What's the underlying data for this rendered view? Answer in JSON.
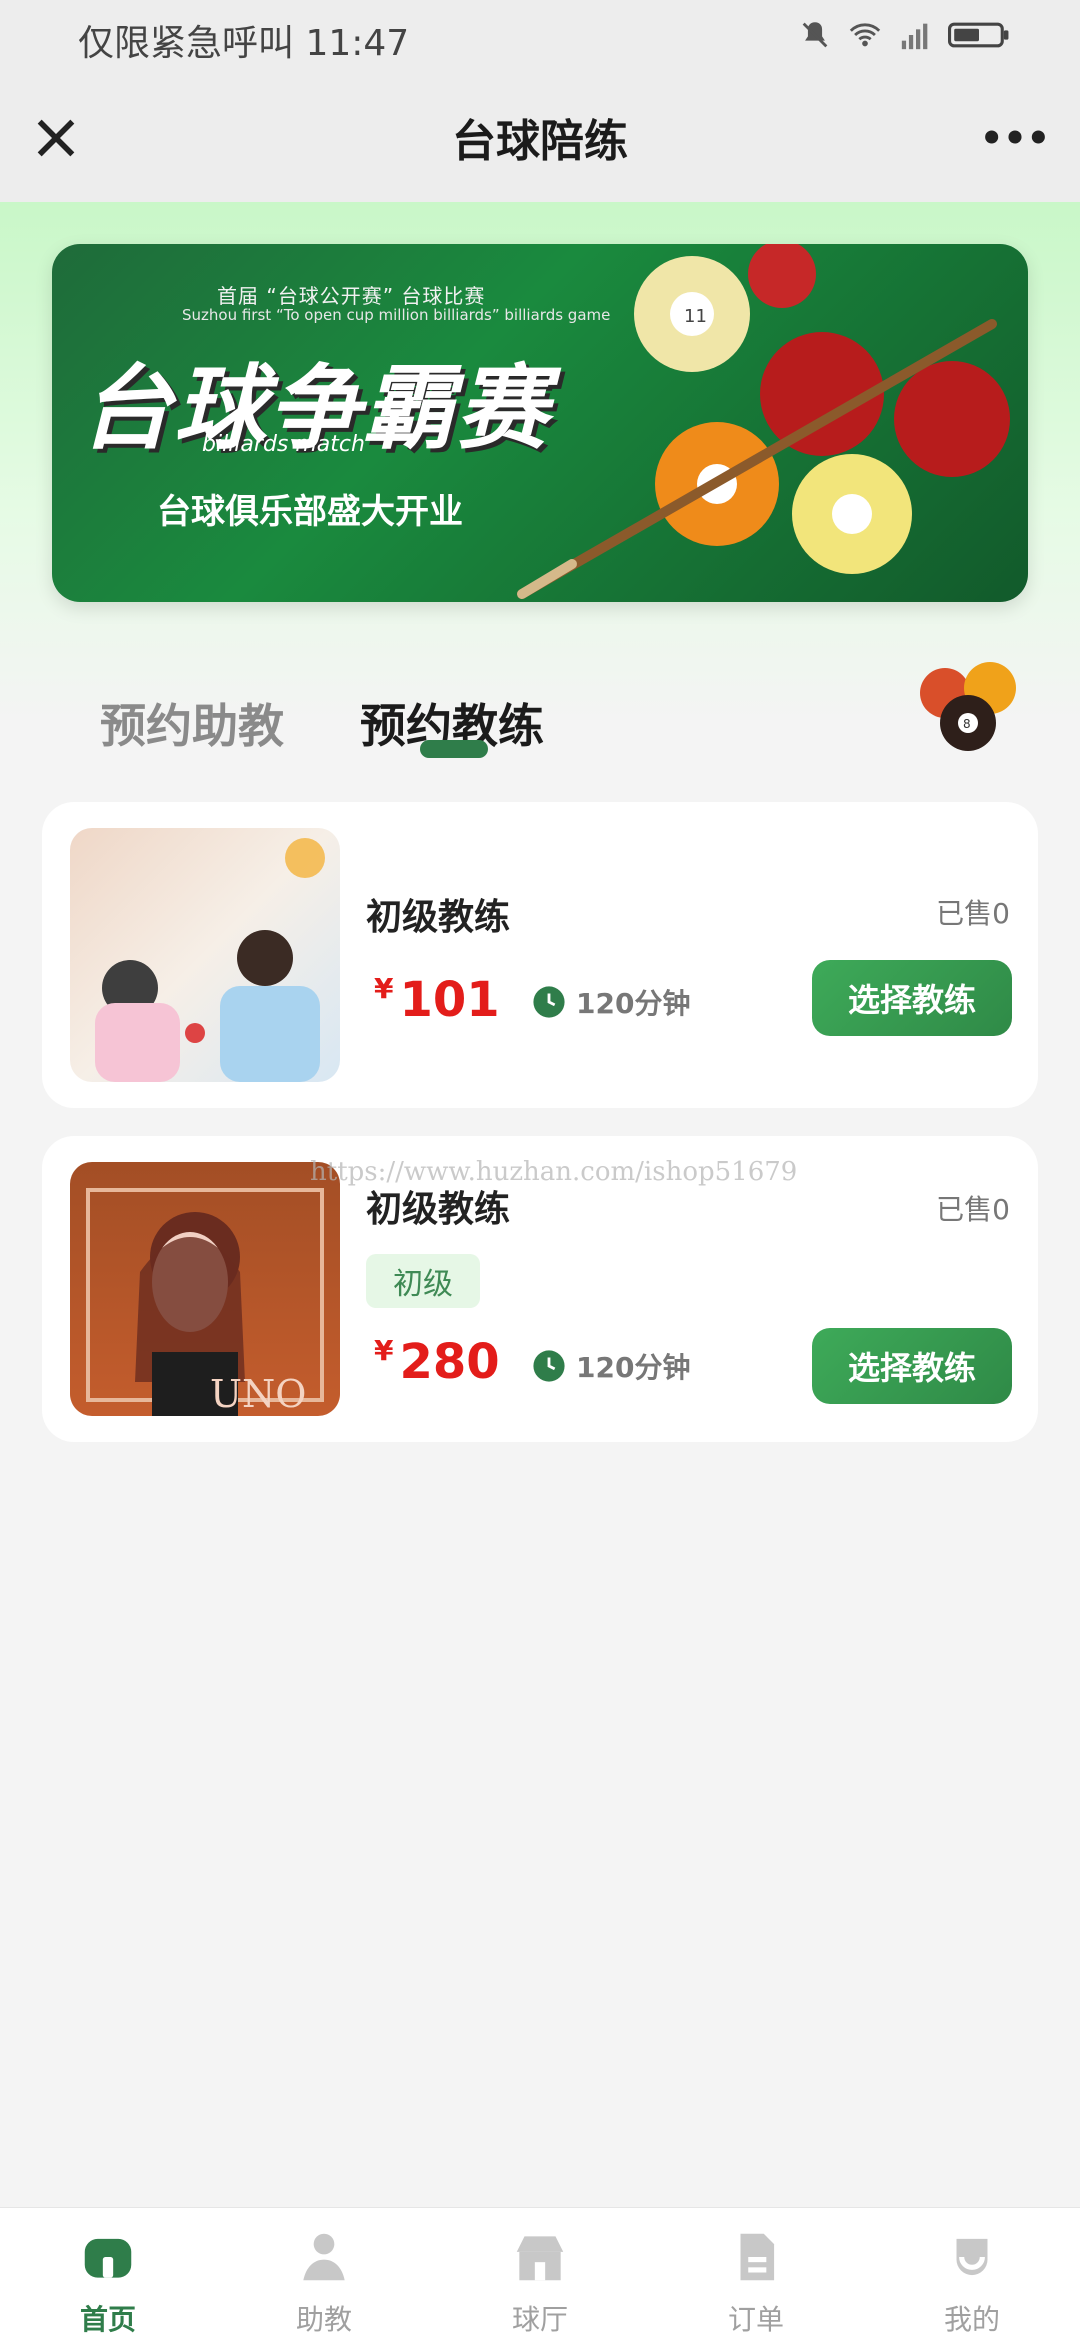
{
  "status_bar": {
    "text": "仅限紧急呼叫 11:47"
  },
  "nav": {
    "title": "台球陪练"
  },
  "banner": {
    "title": "台球争霸赛",
    "line": "台球俱乐部盛大开业",
    "small_top": "首届 “台球公开赛” 台球比赛",
    "small_en": "Suzhou first “To open cup million billiards” billiards game",
    "subtitle_en": "billiards match"
  },
  "tabs": [
    {
      "label": "预约助教"
    },
    {
      "label": "预约教练"
    }
  ],
  "cards": [
    {
      "title": "初级教练",
      "sold": "已售0",
      "currency": "¥",
      "price": "101",
      "duration": "120分钟",
      "button": "选择教练"
    },
    {
      "title": "初级教练",
      "sold": "已售0",
      "level": "初级",
      "currency": "¥",
      "price": "280",
      "duration": "120分钟",
      "button": "选择教练"
    }
  ],
  "watermark": "https://www.huzhan.com/ishop51679",
  "bottom_nav": [
    {
      "label": "首页",
      "icon": "home-icon",
      "active": true
    },
    {
      "label": "助教",
      "icon": "person-icon",
      "active": false
    },
    {
      "label": "球厅",
      "icon": "store-icon",
      "active": false
    },
    {
      "label": "订单",
      "icon": "document-icon",
      "active": false
    },
    {
      "label": "我的",
      "icon": "profile-icon",
      "active": false
    }
  ],
  "colors": {
    "accent": "#2f7d4a",
    "price": "#e31d1a",
    "button": "#3eaa59"
  }
}
